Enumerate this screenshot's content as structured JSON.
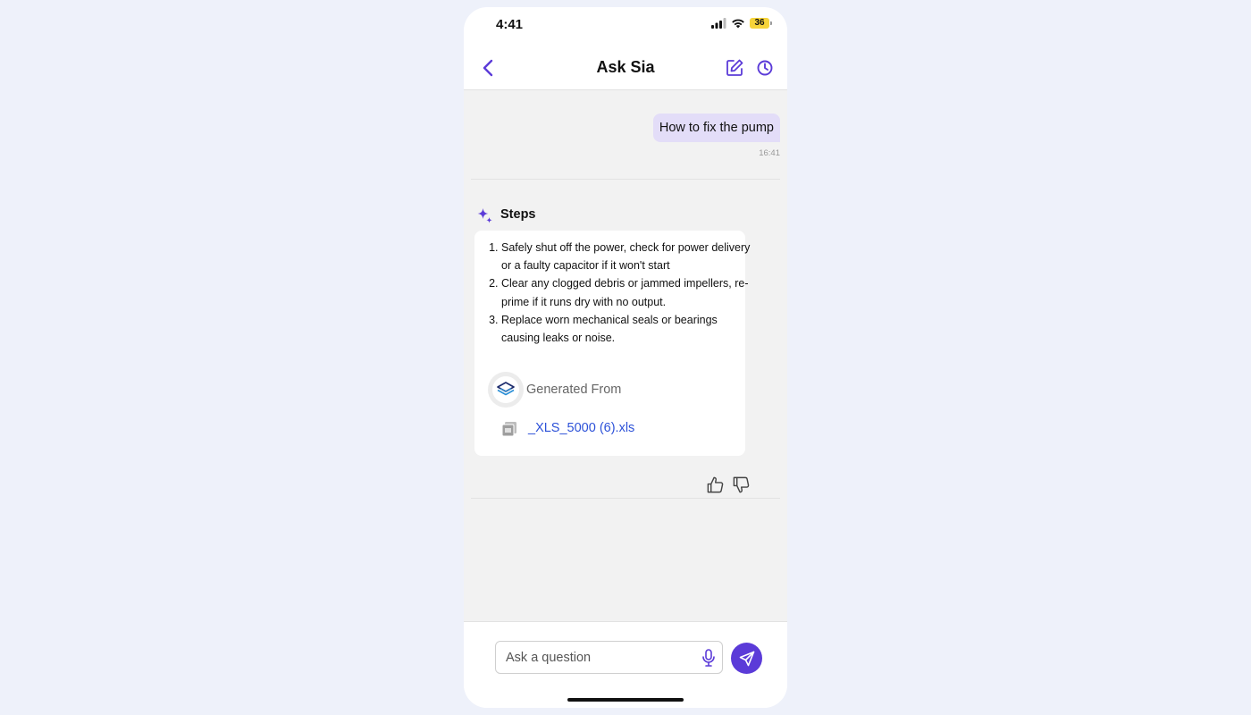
{
  "status_bar": {
    "time": "4:41",
    "battery": "36",
    "icons": [
      "signal-icon",
      "wifi-icon",
      "battery-icon"
    ]
  },
  "header": {
    "title": "Ask Sia",
    "icons": [
      "back-chevron-icon",
      "edit-icon",
      "history-clock-icon"
    ]
  },
  "conversation": {
    "user_message": {
      "text": "How to fix the pump",
      "time": "16:41"
    },
    "answer": {
      "heading": "Steps",
      "heading_icon": "sparkle-icon",
      "steps": [
        "Safely shut off the power, check for power delivery or a faulty capacitor if it won't start",
        "Clear any clogged debris or jammed impellers, re-prime if it runs dry with no output.",
        "Replace worn mechanical seals or bearings causing leaks or noise."
      ],
      "source_label": "Generated From",
      "source_file": "_XLS_5000 (6).xls",
      "feedback_icons": [
        "thumbs-up-icon",
        "thumbs-down-icon"
      ]
    }
  },
  "composer": {
    "placeholder": "Ask a question",
    "value": "",
    "icons": [
      "microphone-icon",
      "send-icon"
    ]
  },
  "colors": {
    "accent": "#5b3bd8",
    "user_bubble": "#e3ddf8",
    "link": "#2c51d8",
    "chat_background": "#f2f2f2",
    "page_background": "#eef1fa"
  }
}
